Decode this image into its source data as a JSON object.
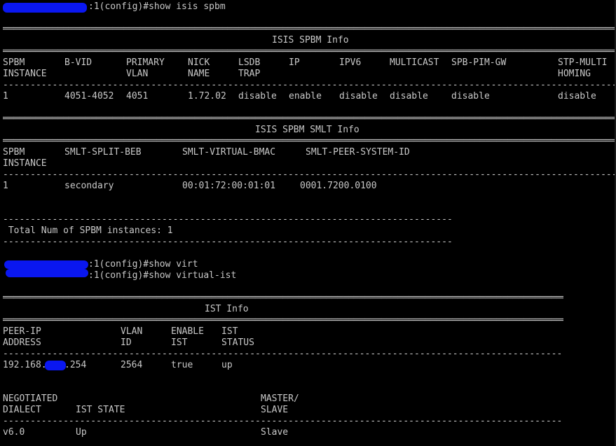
{
  "commands": {
    "cmd1": ":1(config)#show isis spbm",
    "cmd2": ":1(config)#show virt",
    "cmd3": ":1(config)#show virtual-ist"
  },
  "spbm_info": {
    "title": "ISIS SPBM Info",
    "headers_line1": [
      "SPBM",
      "B-VID",
      "PRIMARY",
      "NICK",
      "LSDB",
      "IP",
      "IPV6",
      "MULTICAST",
      "SPB-PIM-GW",
      "STP-MULTI"
    ],
    "headers_line2": [
      "INSTANCE",
      "",
      "VLAN",
      "NAME",
      "TRAP",
      "",
      "",
      "",
      "",
      "HOMING"
    ],
    "row": [
      "1",
      "4051-4052",
      "4051",
      "1.72.02",
      "disable",
      "enable",
      "disable",
      "disable",
      "disable",
      "disable"
    ]
  },
  "smlt_info": {
    "title": "ISIS SPBM SMLT Info",
    "headers_line1": [
      "SPBM",
      "SMLT-SPLIT-BEB",
      "SMLT-VIRTUAL-BMAC",
      "SMLT-PEER-SYSTEM-ID"
    ],
    "headers_line2": [
      "INSTANCE",
      "",
      "",
      ""
    ],
    "row": [
      "1",
      "secondary",
      "00:01:72:00:01:01",
      "0001.7200.0100"
    ]
  },
  "total_line": " Total Num of SPBM instances: 1",
  "ist_info": {
    "title": "IST Info",
    "headers_line1": [
      "PEER-IP",
      "VLAN",
      "ENABLE",
      "IST"
    ],
    "headers_line2": [
      "ADDRESS",
      "ID",
      "IST",
      "STATUS"
    ],
    "row": [
      "192.168.",
      ".254",
      "2564",
      "true",
      "up"
    ],
    "sub_headers_line1": [
      "NEGOTIATED",
      "",
      "MASTER/"
    ],
    "sub_headers_line2": [
      "DIALECT",
      "IST STATE",
      "SLAVE"
    ],
    "sub_row": [
      "v6.0",
      "Up",
      "Slave"
    ]
  },
  "colors": {
    "background": "#000000",
    "text": "#c8c8c8",
    "redaction": "#0a17f0"
  }
}
